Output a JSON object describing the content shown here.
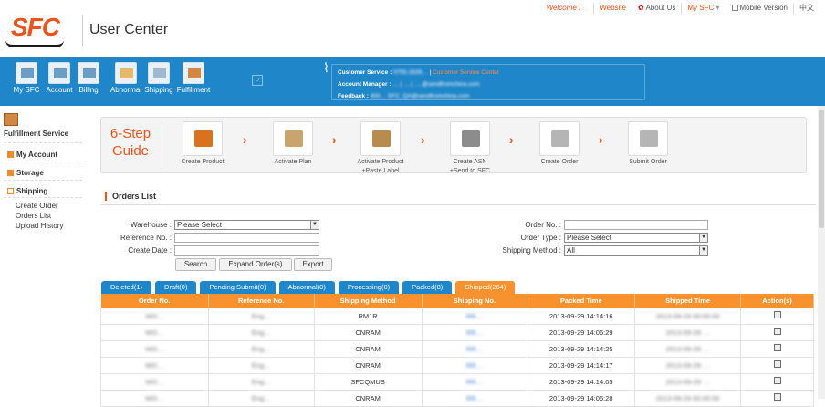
{
  "header": {
    "logo_text": "SFC",
    "title": "User Center",
    "welcome": "Welcome !",
    "username": "…",
    "links": [
      "Website",
      "About Us",
      "My SFC",
      "Mobile Version",
      "中文"
    ]
  },
  "nav": {
    "items": [
      "My SFC",
      "Account",
      "Billing",
      "Abnormal",
      "Shipping",
      "Fulfillment"
    ]
  },
  "service": {
    "line1_label": "Customer Service :",
    "line1_value": "0755-2639…",
    "line1_link": "Customer Service Center",
    "line2_label": "Account Manager :",
    "line2_value": "… | … | ….@sendfromchina.com",
    "line3_label": "Feedback :",
    "line3_value": "400…   SFC_QA@sendfromchina.com"
  },
  "sidebar": {
    "title": "Fulfillment Service",
    "sections": [
      "My Account",
      "Storage",
      "Shipping"
    ],
    "shipping_items": [
      "Create Order",
      "Orders List",
      "Upload History"
    ]
  },
  "guide": {
    "title_line1": "6-Step",
    "title_line2": "Guide",
    "steps": [
      {
        "l1": "Create Product",
        "l2": ""
      },
      {
        "l1": "Activate Plan",
        "l2": ""
      },
      {
        "l1": "Activate Product",
        "l2": "+Paste Label"
      },
      {
        "l1": "Create ASN",
        "l2": "+Send to SFC"
      },
      {
        "l1": "Create Order",
        "l2": ""
      },
      {
        "l1": "Submit Order",
        "l2": ""
      }
    ]
  },
  "orders": {
    "title": "Orders List",
    "warehouse_label": "Warehouse :",
    "warehouse_value": "Please Select",
    "reference_label": "Reference No. :",
    "create_date_label": "Create Date :",
    "order_no_label": "Order No. :",
    "order_type_label": "Order Type :",
    "order_type_value": "Please Select",
    "shipping_method_label": "Shipping Method :",
    "shipping_method_value": "All",
    "buttons": [
      "Search",
      "Expand Order(s)",
      "Export"
    ]
  },
  "tabs": [
    "Deleted(1)",
    "Draft(0)",
    "Pending Submit(0)",
    "Abnormal(0)",
    "Processing(0)",
    "Packed(8)",
    "Shipped(264)"
  ],
  "table": {
    "columns": [
      "Order No.",
      "Reference No.",
      "Shipping Method",
      "Shipping No.",
      "Packed Time",
      "Shipped Time",
      "Action(s)"
    ],
    "rows": [
      [
        "WO…",
        "Eng…",
        "RM1R",
        "RR…",
        "2013-09-29 14:14:16",
        "2013-09-29 00:00:00"
      ],
      [
        "WO…",
        "Eng…",
        "CNRAM",
        "RR…",
        "2013-09-29 14:06:29",
        "2013-09-29 …"
      ],
      [
        "WO…",
        "Eng…",
        "CNRAM",
        "RR…",
        "2013-09-29 14:14:25",
        "2013-09-29 …"
      ],
      [
        "WO…",
        "Eng…",
        "CNRAM",
        "RR…",
        "2013-09-29 14:14:17",
        "2013-09-29 …"
      ],
      [
        "WO…",
        "Eng…",
        "SFCQMUS",
        "RR…",
        "2013-09-29 14:14:05",
        "2013-09-29 …"
      ],
      [
        "WO…",
        "Eng…",
        "CNRAM",
        "RR…",
        "2013-09-29 14:06:28",
        "2013-09-29 00:00:00"
      ]
    ]
  }
}
